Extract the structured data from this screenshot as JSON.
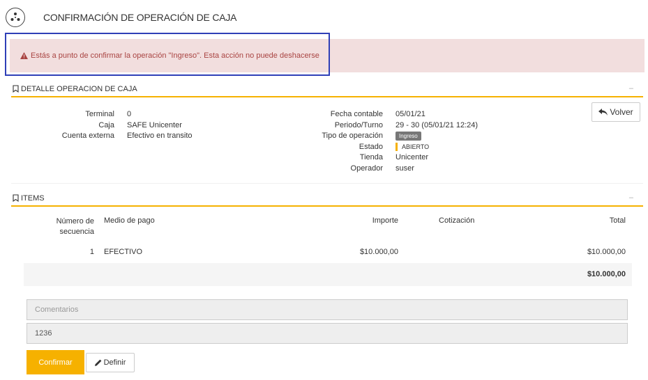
{
  "header": {
    "title": "CONFIRMACIÓN DE OPERACIÓN DE CAJA",
    "logo_icon": "pinwheel-logo-icon"
  },
  "alert": {
    "icon": "warning-triangle-icon",
    "message": "Estás a punto de confirmar la operación \"Ingreso\". Esta acción no puede deshacerse"
  },
  "detail_section": {
    "icon": "bookmark-icon",
    "title": "DETALLE OPERACION DE CAJA",
    "collapse": "–",
    "left": [
      {
        "label": "Terminal",
        "value": "0"
      },
      {
        "label": "Caja",
        "value": "SAFE Unicenter"
      },
      {
        "label": "Cuenta externa",
        "value": "Efectivo en transito"
      }
    ],
    "right": [
      {
        "label": "Fecha contable",
        "value": "05/01/21"
      },
      {
        "label": "Periodo/Turno",
        "value": "29 - 30 (05/01/21 12:24)"
      },
      {
        "label": "Tipo de operación",
        "value": "Ingreso"
      },
      {
        "label": "Estado",
        "value": "ABIERTO"
      },
      {
        "label": "Tienda",
        "value": "Unicenter"
      },
      {
        "label": "Operador",
        "value": "suser"
      }
    ],
    "back_button": {
      "icon": "reply-arrow-icon",
      "label": "Volver"
    }
  },
  "items_section": {
    "icon": "bookmark-icon",
    "title": "ITEMS",
    "collapse": "–",
    "columns": {
      "seq_line1": "Número de",
      "seq_line2": "secuencia",
      "medio": "Medio de pago",
      "importe": "Importe",
      "cotizacion": "Cotización",
      "total": "Total"
    },
    "rows": [
      {
        "seq": "1",
        "medio": "EFECTIVO",
        "importe": "$10.000,00",
        "cotizacion": "",
        "total": "$10.000,00"
      }
    ],
    "grand_total": "$10.000,00"
  },
  "form": {
    "comments_placeholder": "Comentarios",
    "code_value": "1236",
    "confirm_label": "Confirmar",
    "define_label": "Definir",
    "define_icon": "pencil-icon"
  },
  "colors": {
    "accent": "#f6b100",
    "alert_bg": "#f2dede",
    "alert_text": "#a94442",
    "focus_outline": "#2f3fb7"
  }
}
